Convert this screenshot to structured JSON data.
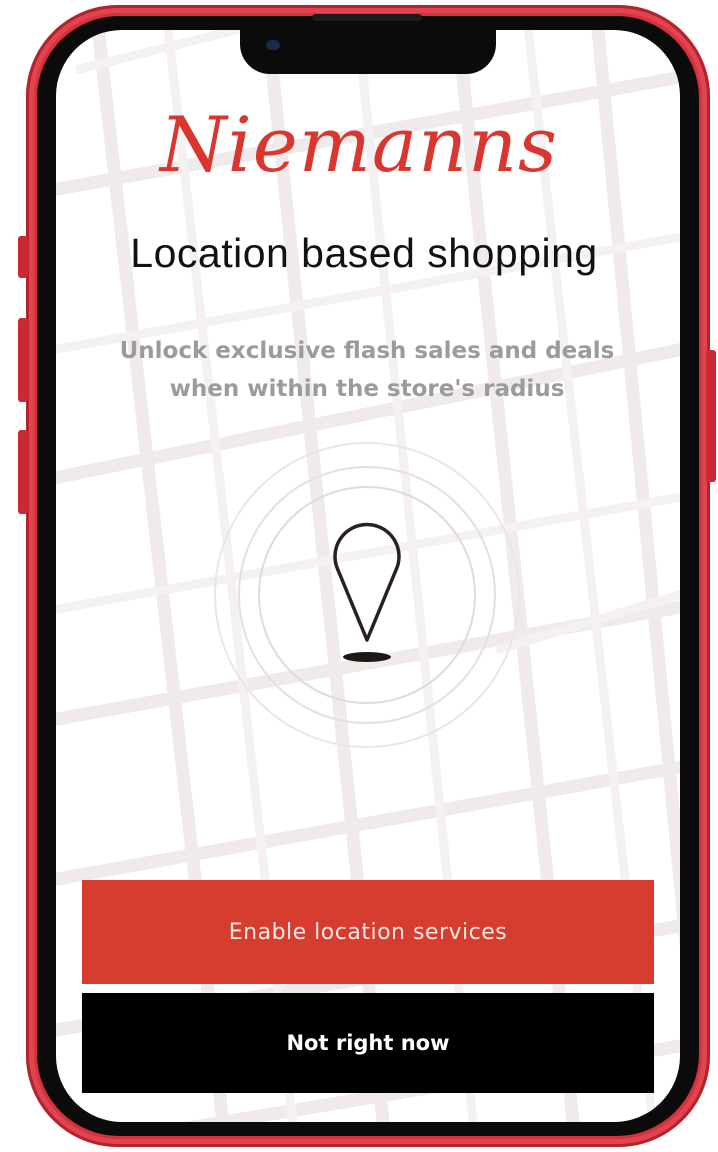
{
  "brand": {
    "logo_text": "Niemanns",
    "color": "#d8362f"
  },
  "onboarding": {
    "title": "Location based shopping",
    "description": "Unlock exclusive flash sales and deals when within the store's radius",
    "illustration_icon": "map-pin-icon"
  },
  "actions": {
    "primary_label": "Enable location services",
    "secondary_label": "Not right now"
  },
  "colors": {
    "phone_frame": "#d6313d",
    "primary_button": "#d63d2e",
    "secondary_button": "#000000",
    "subtitle_text": "#9b9b9b"
  }
}
